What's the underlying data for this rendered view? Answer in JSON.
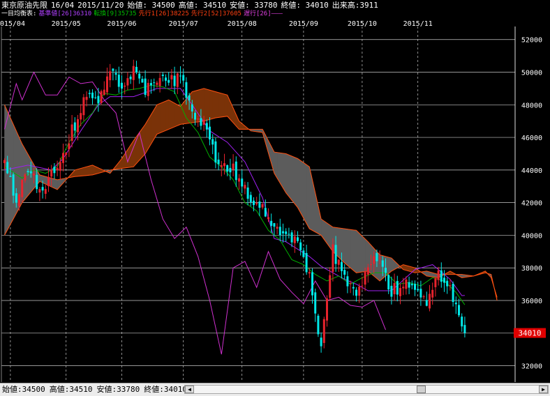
{
  "header": {
    "title": "東京原油先限",
    "contract": "16/04",
    "date": "2015/11/20",
    "open": "始値: 34500",
    "high": "高値: 34510",
    "low": "安値: 33780",
    "close": "終値: 34010",
    "volume": "出来高:3911"
  },
  "legend": {
    "prefix": "一目均衡表:",
    "base": "基準値[26]36310",
    "conv": "転換[9]35735",
    "spanA": "先行1[26]38225",
    "spanB": "先行2[52]37605",
    "lag": "遅行[26]———"
  },
  "status": {
    "open": "始値:34500",
    "high": "高値:34510",
    "low": "安値:33780",
    "close": "終値:34010",
    "scroll_left": "◀",
    "scroll_right": "▶"
  },
  "colors": {
    "up": "#e8232d",
    "down": "#00e8e8",
    "base": "#a020f0",
    "conv": "#00b000",
    "lag": "#d030d0",
    "spanA": "#ff5010",
    "spanB": "#ff5010",
    "cloud_bull": "#7a3208",
    "cloud_bear": "#5c5c5c",
    "last_price_bg": "#e00000"
  },
  "chart_data": {
    "type": "candlestick",
    "title": "東京原油先限 16/04",
    "y_ticks": [
      32000,
      34000,
      36000,
      38000,
      40000,
      42000,
      44000,
      46000,
      48000,
      50000,
      52000
    ],
    "ylim": [
      31000,
      52800
    ],
    "grid": true,
    "last_price": 34010,
    "last_price_label": "34010",
    "month_labels": [
      {
        "label": "2015/04",
        "day": 2
      },
      {
        "label": "2015/05",
        "day": 21
      },
      {
        "label": "2015/06",
        "day": 40
      },
      {
        "label": "2015/07",
        "day": 61
      },
      {
        "label": "2015/08",
        "day": 81
      },
      {
        "label": "2015/09",
        "day": 102
      },
      {
        "label": "2015/10",
        "day": 122
      },
      {
        "label": "2015/11",
        "day": 141
      }
    ],
    "ohlc_points": [
      [
        0,
        44500
      ],
      [
        4,
        42000
      ],
      [
        8,
        44000
      ],
      [
        12,
        42800
      ],
      [
        16,
        43600
      ],
      [
        20,
        45000
      ],
      [
        24,
        46800
      ],
      [
        28,
        48500
      ],
      [
        32,
        48200
      ],
      [
        36,
        50300
      ],
      [
        40,
        49300
      ],
      [
        44,
        50100
      ],
      [
        48,
        48700
      ],
      [
        52,
        49500
      ],
      [
        56,
        49300
      ],
      [
        60,
        49600
      ],
      [
        64,
        47600
      ],
      [
        68,
        46800
      ],
      [
        72,
        44600
      ],
      [
        76,
        44300
      ],
      [
        80,
        43600
      ],
      [
        84,
        41800
      ],
      [
        88,
        41800
      ],
      [
        92,
        40500
      ],
      [
        96,
        40400
      ],
      [
        100,
        39400
      ],
      [
        104,
        37300
      ],
      [
        108,
        33000
      ],
      [
        112,
        39000
      ],
      [
        116,
        37200
      ],
      [
        120,
        36600
      ],
      [
        124,
        37800
      ],
      [
        128,
        38800
      ],
      [
        132,
        36500
      ],
      [
        136,
        37000
      ],
      [
        140,
        36600
      ],
      [
        144,
        36000
      ],
      [
        148,
        37800
      ],
      [
        152,
        37000
      ],
      [
        154,
        35500
      ],
      [
        156,
        34200
      ],
      [
        157,
        34010
      ]
    ],
    "base_line": [
      [
        0,
        44000
      ],
      [
        8,
        44300
      ],
      [
        16,
        44000
      ],
      [
        20,
        44700
      ],
      [
        26,
        46400
      ],
      [
        32,
        48000
      ],
      [
        36,
        48500
      ],
      [
        44,
        48500
      ],
      [
        52,
        49000
      ],
      [
        60,
        49000
      ],
      [
        64,
        48000
      ],
      [
        70,
        46400
      ],
      [
        76,
        45700
      ],
      [
        82,
        44500
      ],
      [
        88,
        42300
      ],
      [
        92,
        39800
      ],
      [
        96,
        39600
      ],
      [
        104,
        38700
      ],
      [
        108,
        38100
      ],
      [
        116,
        37300
      ],
      [
        120,
        37000
      ],
      [
        124,
        36600
      ],
      [
        132,
        36600
      ],
      [
        140,
        37900
      ],
      [
        146,
        38200
      ],
      [
        152,
        37300
      ],
      [
        156,
        36300
      ],
      [
        157,
        36310
      ]
    ],
    "conv_line": [
      [
        0,
        44200
      ],
      [
        6,
        43500
      ],
      [
        10,
        44000
      ],
      [
        14,
        43800
      ],
      [
        18,
        44200
      ],
      [
        22,
        45700
      ],
      [
        26,
        46800
      ],
      [
        30,
        47500
      ],
      [
        34,
        48700
      ],
      [
        38,
        48600
      ],
      [
        42,
        48900
      ],
      [
        46,
        49000
      ],
      [
        50,
        49200
      ],
      [
        54,
        49100
      ],
      [
        58,
        48800
      ],
      [
        62,
        47200
      ],
      [
        66,
        46300
      ],
      [
        70,
        44800
      ],
      [
        74,
        44200
      ],
      [
        78,
        43400
      ],
      [
        82,
        42000
      ],
      [
        86,
        41500
      ],
      [
        90,
        40300
      ],
      [
        94,
        39700
      ],
      [
        98,
        38500
      ],
      [
        102,
        38200
      ],
      [
        106,
        37600
      ],
      [
        110,
        37200
      ],
      [
        114,
        37500
      ],
      [
        118,
        37000
      ],
      [
        122,
        37400
      ],
      [
        126,
        37700
      ],
      [
        130,
        37700
      ],
      [
        134,
        37000
      ],
      [
        138,
        37100
      ],
      [
        142,
        36900
      ],
      [
        146,
        37400
      ],
      [
        150,
        37200
      ],
      [
        154,
        36500
      ],
      [
        157,
        35735
      ]
    ],
    "lag_line": [
      [
        0,
        46500
      ],
      [
        4,
        49300
      ],
      [
        6,
        48300
      ],
      [
        10,
        50000
      ],
      [
        14,
        48600
      ],
      [
        18,
        48600
      ],
      [
        22,
        49700
      ],
      [
        26,
        49300
      ],
      [
        30,
        49400
      ],
      [
        34,
        48300
      ],
      [
        38,
        47500
      ],
      [
        42,
        44500
      ],
      [
        46,
        46300
      ],
      [
        50,
        43400
      ],
      [
        54,
        41000
      ],
      [
        58,
        39800
      ],
      [
        62,
        40500
      ],
      [
        66,
        38700
      ],
      [
        70,
        36000
      ],
      [
        74,
        32700
      ],
      [
        78,
        38000
      ],
      [
        82,
        38400
      ],
      [
        86,
        36800
      ],
      [
        90,
        39000
      ],
      [
        94,
        37300
      ],
      [
        98,
        36500
      ],
      [
        102,
        35800
      ],
      [
        106,
        37200
      ],
      [
        110,
        36000
      ],
      [
        114,
        36200
      ],
      [
        118,
        35700
      ],
      [
        122,
        35600
      ],
      [
        126,
        36000
      ],
      [
        130,
        34200
      ]
    ],
    "span_a": [
      [
        0,
        40000
      ],
      [
        6,
        42000
      ],
      [
        12,
        43300
      ],
      [
        18,
        42800
      ],
      [
        24,
        44000
      ],
      [
        30,
        44300
      ],
      [
        36,
        43800
      ],
      [
        40,
        44700
      ],
      [
        44,
        45800
      ],
      [
        48,
        46800
      ],
      [
        52,
        48000
      ],
      [
        56,
        48300
      ],
      [
        60,
        47900
      ],
      [
        64,
        48800
      ],
      [
        68,
        49000
      ],
      [
        72,
        48800
      ],
      [
        76,
        48600
      ],
      [
        80,
        47000
      ],
      [
        84,
        46400
      ],
      [
        88,
        46300
      ],
      [
        92,
        43800
      ],
      [
        96,
        42600
      ],
      [
        100,
        41700
      ],
      [
        104,
        40400
      ],
      [
        108,
        40000
      ],
      [
        112,
        39000
      ],
      [
        116,
        38300
      ],
      [
        120,
        37700
      ],
      [
        124,
        37800
      ],
      [
        128,
        37200
      ],
      [
        132,
        37800
      ],
      [
        136,
        38200
      ],
      [
        140,
        38000
      ],
      [
        144,
        37500
      ],
      [
        148,
        37400
      ],
      [
        152,
        37800
      ],
      [
        156,
        37400
      ],
      [
        160,
        37500
      ],
      [
        164,
        37800
      ],
      [
        166,
        37400
      ],
      [
        168,
        36200
      ]
    ],
    "span_b": [
      [
        0,
        48000
      ],
      [
        6,
        45600
      ],
      [
        12,
        43700
      ],
      [
        18,
        43400
      ],
      [
        24,
        43600
      ],
      [
        30,
        43700
      ],
      [
        36,
        44000
      ],
      [
        40,
        44100
      ],
      [
        44,
        44200
      ],
      [
        48,
        45000
      ],
      [
        52,
        46200
      ],
      [
        56,
        46500
      ],
      [
        60,
        46800
      ],
      [
        64,
        46900
      ],
      [
        68,
        47000
      ],
      [
        72,
        47200
      ],
      [
        76,
        47300
      ],
      [
        80,
        46500
      ],
      [
        84,
        46500
      ],
      [
        88,
        46500
      ],
      [
        92,
        45100
      ],
      [
        96,
        45000
      ],
      [
        100,
        44700
      ],
      [
        104,
        44200
      ],
      [
        108,
        41000
      ],
      [
        112,
        40500
      ],
      [
        116,
        40400
      ],
      [
        120,
        40300
      ],
      [
        124,
        39600
      ],
      [
        128,
        38800
      ],
      [
        132,
        38600
      ],
      [
        136,
        37900
      ],
      [
        140,
        37700
      ],
      [
        144,
        37800
      ],
      [
        148,
        37600
      ],
      [
        152,
        37600
      ],
      [
        156,
        37600
      ],
      [
        160,
        37500
      ],
      [
        164,
        37700
      ],
      [
        166,
        37600
      ],
      [
        168,
        36000
      ]
    ]
  }
}
